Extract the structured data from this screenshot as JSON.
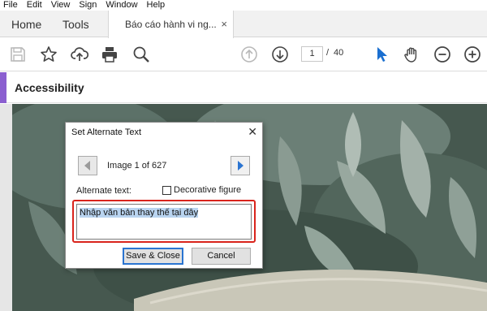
{
  "menubar": {
    "items": [
      "File",
      "Edit",
      "View",
      "Sign",
      "Window",
      "Help"
    ]
  },
  "tabs": {
    "home": "Home",
    "tools": "Tools",
    "document": "Báo cáo hành vi ng...",
    "close_glyph": "×"
  },
  "toolbar": {
    "icons": [
      "save-icon",
      "star-icon",
      "upload-cloud-icon",
      "print-icon",
      "zoom-search-icon",
      "page-up-icon",
      "page-down-icon",
      "select-pointer-icon",
      "hand-tool-icon",
      "zoom-out-icon",
      "zoom-in-icon"
    ],
    "current_page": "1",
    "page_separator": "/",
    "total_pages": "40",
    "accent_color": "#1a6fd0"
  },
  "panel": {
    "title": "Accessibility",
    "accent_color": "#8b5fd0"
  },
  "dialog": {
    "title": "Set Alternate Text",
    "close_glyph": "✕",
    "counter": "Image 1 of 627",
    "alt_text_label": "Alternate text:",
    "decorative_label": "Decorative figure",
    "decorative_checked": false,
    "alt_text_value": "Nhập văn bản thay thế tại đây",
    "save_button": "Save & Close",
    "cancel_button": "Cancel",
    "highlight_color": "#d9241c"
  }
}
